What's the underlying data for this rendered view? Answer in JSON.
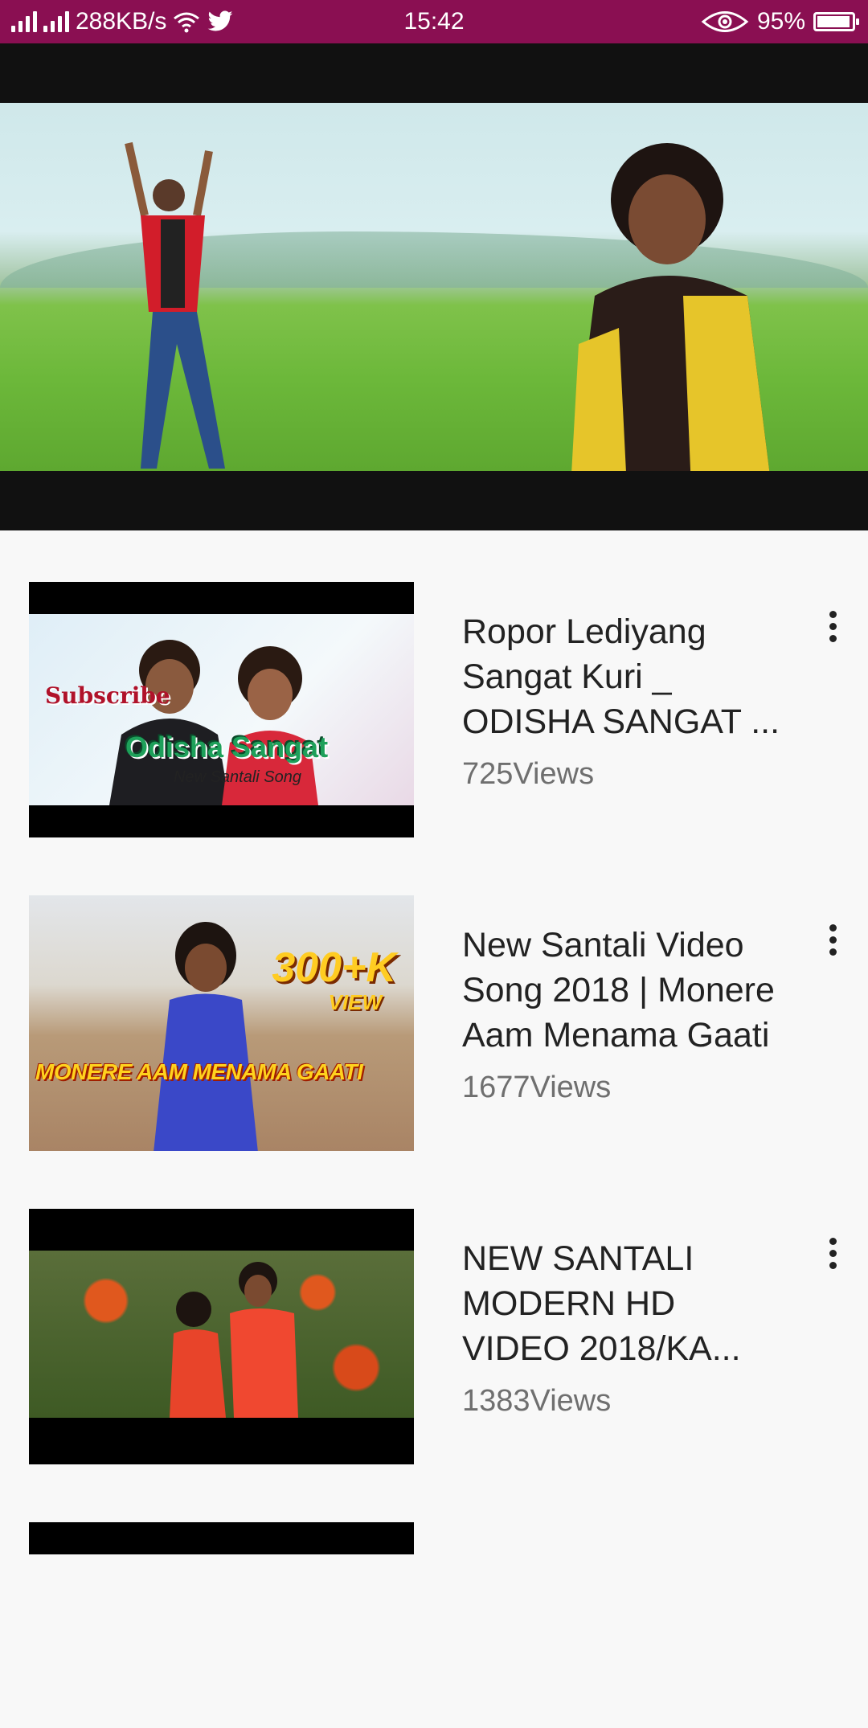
{
  "status_bar": {
    "speed": "288KB/s",
    "time": "15:42",
    "battery": "95%",
    "battery_level": 0.95
  },
  "videos": [
    {
      "title": "Ropor Lediyang Sangat Kuri _ ODISHA SANGAT ...",
      "views": "725Views",
      "thumb_text": {
        "subscribe": "Subscribe",
        "main": "Odisha Sangat",
        "sub": "New Santali Song"
      }
    },
    {
      "title": "New Santali Video Song 2018 | Monere Aam Menama Gaati",
      "views": "1677Views",
      "thumb_text": {
        "badge": "300+K",
        "badge_sub": "VIEW",
        "main": "MONERE AAM MENAMA GAATI"
      }
    },
    {
      "title": "NEW SANTALI MODERN HD VIDEO 2018/KA...",
      "views": "1383Views",
      "thumb_text": {}
    }
  ]
}
